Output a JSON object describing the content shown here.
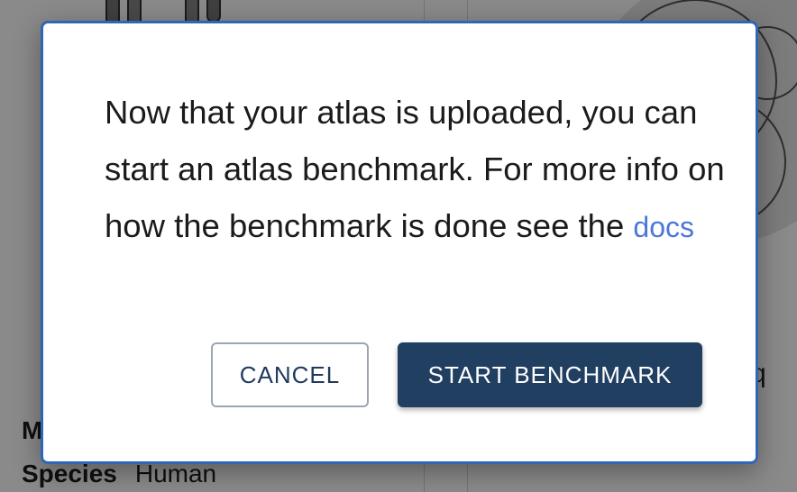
{
  "background": {
    "meta_label": "M",
    "species_key": "Species",
    "species_value": "Human",
    "right_fragment": "q"
  },
  "modal": {
    "message": "Now that your atlas is uploaded, you can start an atlas benchmark. For more info on how the benchmark is done see the",
    "docs_link_label": "docs",
    "cancel_label": "CANCEL",
    "start_label": "START BENCHMARK"
  },
  "colors": {
    "primary": "#213f60",
    "link": "#4c78d6",
    "modal_border": "#2f66b8"
  }
}
